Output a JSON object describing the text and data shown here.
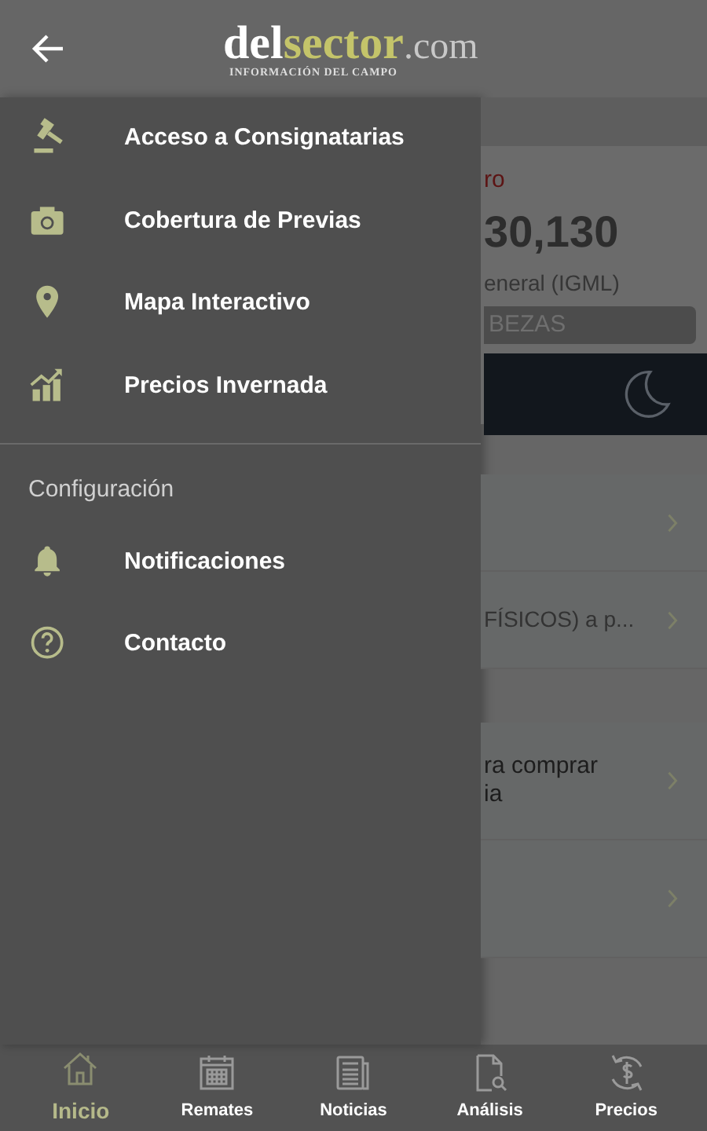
{
  "header": {
    "logo": {
      "part_1": "del",
      "part_2": "sector",
      "part_3": ".com",
      "tagline": "INFORMACIÓN DEL CAMPO"
    }
  },
  "drawer": {
    "sections": [
      {
        "items": [
          {
            "kind": "gavel",
            "label": "Acceso a Consignatarias"
          },
          {
            "kind": "camera",
            "label": "Cobertura de Previas"
          },
          {
            "kind": "pin",
            "label": "Mapa Interactivo"
          },
          {
            "kind": "chart",
            "label": "Precios Invernada"
          }
        ]
      },
      {
        "heading": "Configuración",
        "items": [
          {
            "kind": "bell",
            "label": "Notificaciones"
          },
          {
            "kind": "help",
            "label": "Contacto"
          }
        ]
      }
    ]
  },
  "background": {
    "indicator_card": {
      "label": "ro",
      "value": "30,130",
      "caption": "eneral (IGML)",
      "badge": "BEZAS"
    },
    "list_1": [
      {
        "kind": "blank"
      },
      {
        "kind": "text",
        "lines": [
          "FÍSICOS) a p..."
        ]
      }
    ],
    "list_2": [
      {
        "kind": "text",
        "lines": [
          "ra comprar",
          "ia"
        ]
      },
      {
        "kind": "blank"
      }
    ]
  },
  "bottom_nav": [
    {
      "kind": "home",
      "label": "Inicio",
      "selected": true
    },
    {
      "kind": "calendar",
      "label": "Remates",
      "selected": false
    },
    {
      "kind": "news",
      "label": "Noticias",
      "selected": false
    },
    {
      "kind": "analysis",
      "label": "Análisis",
      "selected": false
    },
    {
      "kind": "price",
      "label": "Precios",
      "selected": false
    }
  ]
}
